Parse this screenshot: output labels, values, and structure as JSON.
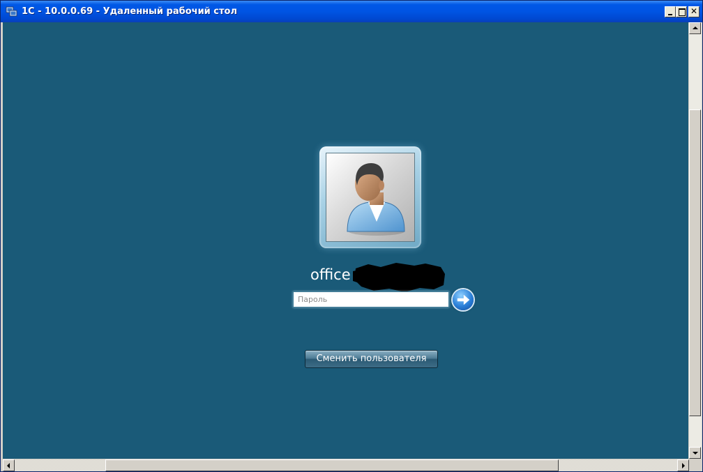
{
  "window": {
    "title": "1С - 10.0.0.69 - Удаленный рабочий стол",
    "icon": "remote-desktop-icon",
    "buttons": [
      "minimize",
      "maximize",
      "close"
    ]
  },
  "login": {
    "avatar_icon": "user-avatar-icon",
    "username": "office",
    "username_redacted": true,
    "password_placeholder": "Пароль",
    "password_value": "",
    "submit_icon": "arrow-right-icon",
    "switch_user_label": "Сменить пользователя"
  },
  "colors": {
    "desktop_background": "#1a5a78",
    "titlebar": "#0054e3"
  }
}
